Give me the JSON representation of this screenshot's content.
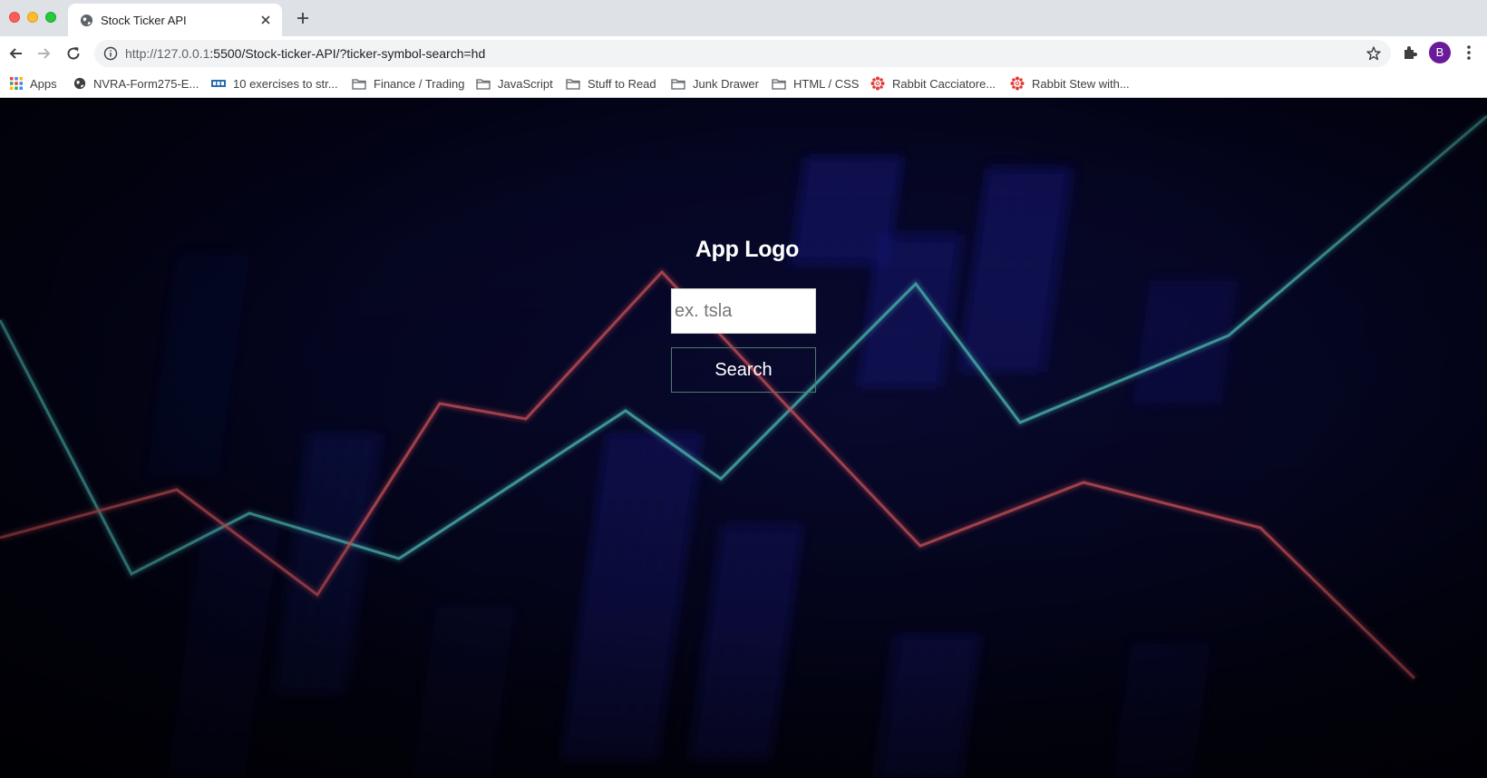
{
  "browser": {
    "tab": {
      "title": "Stock Ticker API"
    },
    "address": {
      "url_host": "http://127.0.0.1",
      "url_rest": ":5500/Stock-ticker-API/?ticker-symbol-search=hd"
    },
    "profile_initial": "B"
  },
  "bookmarks": [
    {
      "label": "Apps",
      "icon": "apps-grid-icon"
    },
    {
      "label": "NVRA-Form275-E...",
      "icon": "globe-icon"
    },
    {
      "label": "10 exercises to str...",
      "icon": "site-favicon-icon"
    },
    {
      "label": "Finance / Trading",
      "icon": "folder-icon"
    },
    {
      "label": "JavaScript",
      "icon": "folder-icon"
    },
    {
      "label": "Stuff to Read",
      "icon": "folder-icon"
    },
    {
      "label": "Junk Drawer",
      "icon": "folder-icon"
    },
    {
      "label": "HTML / CSS",
      "icon": "folder-icon"
    },
    {
      "label": "Rabbit Cacciatore...",
      "icon": "recipe-favicon-icon"
    },
    {
      "label": "Rabbit Stew with...",
      "icon": "recipe-favicon-icon"
    }
  ],
  "app": {
    "logo_text": "App Logo",
    "search": {
      "placeholder": "ex. tsla",
      "value": ""
    },
    "search_button_label": "Search"
  },
  "colors": {
    "input_border": "#cfcfcf",
    "button_border": "#4d7a6a",
    "teal_line": "#3fa6a6",
    "red_line": "#c0444c"
  }
}
